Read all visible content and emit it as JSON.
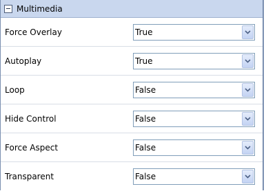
{
  "section": {
    "title": "Multimedia",
    "collapse_icon": "minus-box-icon"
  },
  "properties": [
    {
      "label": "Force Overlay",
      "value": "True"
    },
    {
      "label": "Autoplay",
      "value": "True"
    },
    {
      "label": "Loop",
      "value": "False"
    },
    {
      "label": "Hide Control",
      "value": "False"
    },
    {
      "label": "Force Aspect",
      "value": "False"
    },
    {
      "label": "Transparent",
      "value": "False"
    }
  ],
  "colors": {
    "header_bg": "#c9d7ee",
    "dropdown_border": "#7f9db9",
    "arrow_glyph": "#4d6185"
  }
}
